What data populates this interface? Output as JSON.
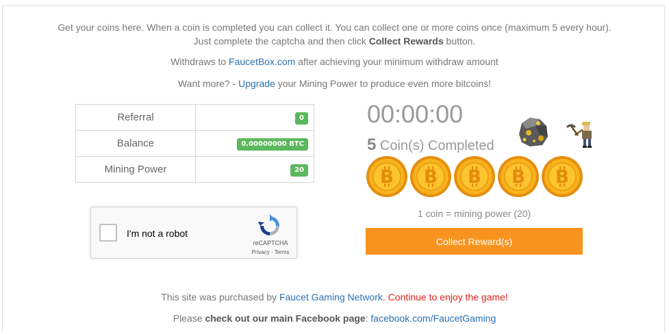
{
  "intro": {
    "line1": "Get your coins here. When a coin is completed you can collect it. You can collect one or more coins once (maximum 5 every hour).",
    "line2_pre": "Just complete the captcha and then click ",
    "line2_bold": "Collect Rewards",
    "line2_post": " button."
  },
  "withdraw": {
    "pre": "Withdraws to ",
    "link": "FaucetBox.com",
    "post": " after achieving your minimum withdraw amount"
  },
  "upgrade": {
    "pre": "Want more? - ",
    "link": "Upgrade",
    "post": " your Mining Power to produce even more bitcoins!"
  },
  "stats": [
    {
      "label": "Referral",
      "value": "0"
    },
    {
      "label": "Balance",
      "value": "0.00000000 BTC"
    },
    {
      "label": "Mining Power",
      "value": "20"
    }
  ],
  "captcha": {
    "label": "I'm not a robot",
    "brand": "reCAPTCHA",
    "links": "Privacy - Terms"
  },
  "mining": {
    "timer": "00:00:00",
    "completed_count": "5",
    "completed_text": "Coin(s) Completed",
    "coin_symbol": "B",
    "coins_shown": 5,
    "rate": "1 coin = mining power (20)",
    "collect_label": "Collect Reward(s)"
  },
  "footer": {
    "line1_pre": "This site was purchased by ",
    "line1_link": "Faucet Gaming Network",
    "line1_red": ". Continue to enjoy the game!",
    "line2_pre": "Please ",
    "line2_bold": "check out our main Facebook page",
    "line2_mid": ": ",
    "line2_link": "facebook.com/FaucetGaming"
  },
  "colors": {
    "accent": "#f7931e",
    "badge": "#5cb85c",
    "link": "#2a6fb0",
    "alert": "#e0201b"
  }
}
